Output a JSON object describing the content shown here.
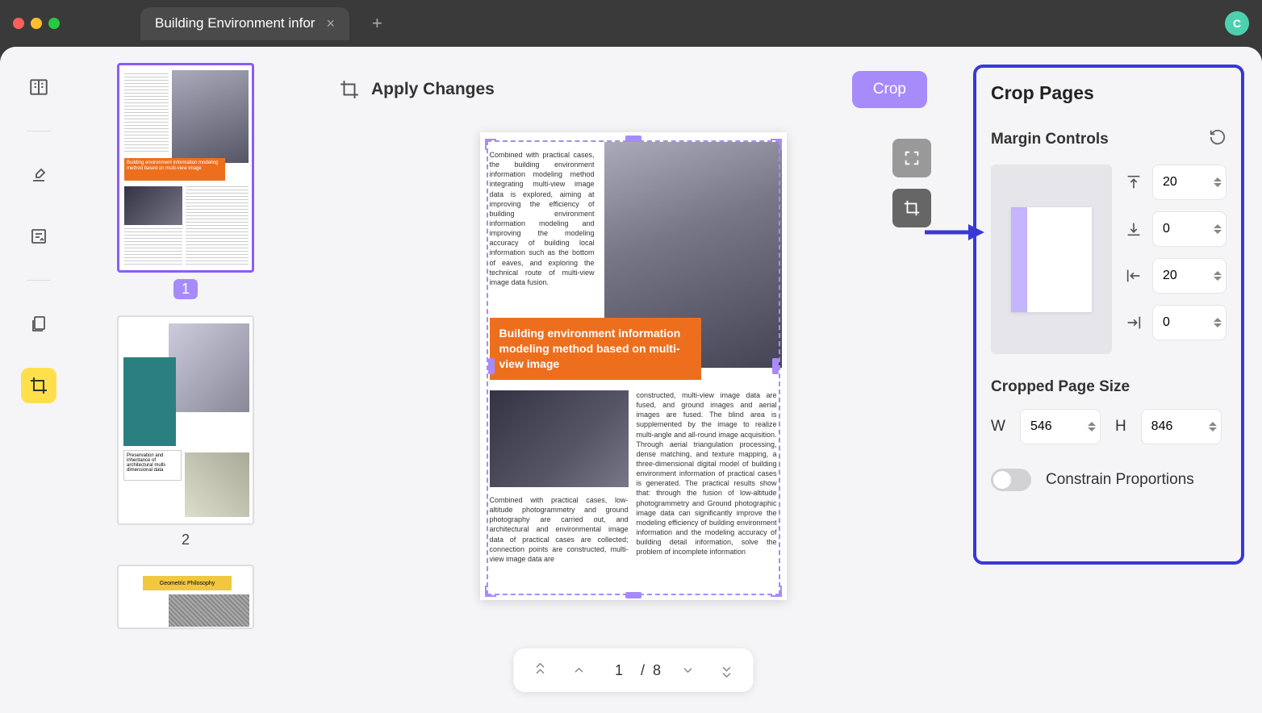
{
  "titlebar": {
    "tab_title": "Building Environment infor",
    "avatar_letter": "C"
  },
  "canvas": {
    "header_title": "Apply Changes",
    "crop_button": "Crop"
  },
  "pager": {
    "current": "1",
    "sep": "/",
    "total": "8"
  },
  "thumbs": {
    "p1_num": "1",
    "p1_banner": "Building environment information modeling method based on multi-view image",
    "p2_num": "2",
    "p2_banner": "Preservation and inheritance of architectural multi-dimensional data",
    "p3_banner": "Geometric Philosophy"
  },
  "page_content": {
    "text1": "Combined with practical cases, the building environment information modeling method integrating multi-view image data is explored, aiming at improving the efficiency of building environment information modeling and improving the modeling accuracy of building local information such as the bottom of eaves, and exploring the technical route of multi-view image data fusion.",
    "banner": "Building environment information modeling method based on multi-view image",
    "text2": "constructed, multi-view image data are fused, and ground images and aerial images are fused. The blind area is supplemented by the image to realize multi-angle and all-round image acquisition. Through aerial triangulation processing, dense matching, and texture mapping, a three-dimensional digital model of building environment information of practical cases is generated. The practical results show that: through the fusion of low-altitude photogrammetry and Ground photographic image data can significantly improve the modeling efficiency of building environment information and the modeling accuracy of building detail information, solve the problem of incomplete information",
    "text3": "Combined with practical cases, low-altitude photogrammetry and ground photography are carried out, and architectural and environmental image data of practical cases are collected; connection points are constructed, multi-view image data are"
  },
  "rpanel": {
    "title": "Crop Pages",
    "margin_title": "Margin Controls",
    "margins": {
      "top": "20",
      "bottom": "0",
      "left": "20",
      "right": "0"
    },
    "size_title": "Cropped Page Size",
    "w_label": "W",
    "h_label": "H",
    "width": "546",
    "height": "846",
    "constrain_label": "Constrain Proportions"
  }
}
